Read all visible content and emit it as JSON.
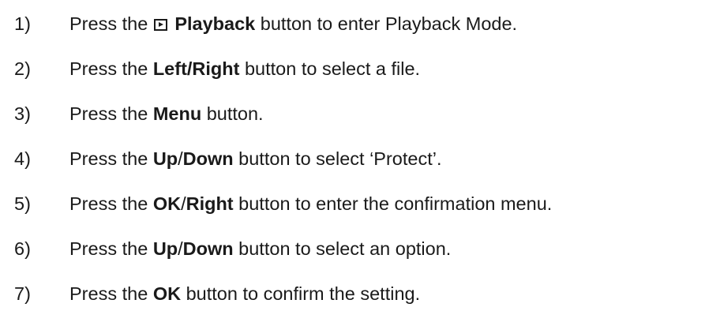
{
  "steps": [
    {
      "number": "1)",
      "pre": "Press the",
      "icon": "playback-icon",
      "bold": "Playback",
      "post": "button to enter Playback Mode."
    },
    {
      "number": "2)",
      "pre": "Press the",
      "bold": "Left/Right",
      "post": "button to select a file."
    },
    {
      "number": "3)",
      "pre": "Press the",
      "bold": "Menu",
      "post": "button."
    },
    {
      "number": "4)",
      "pre": "Press the",
      "bold_a": "Up",
      "sep": "/",
      "bold_b": "Down",
      "post": "button to select ‘Protect’."
    },
    {
      "number": "5)",
      "pre": "Press the",
      "bold_a": "OK",
      "sep": "/",
      "bold_b": "Right",
      "post": "button to enter the confirmation menu."
    },
    {
      "number": "6)",
      "pre": "Press the",
      "bold_a": "Up",
      "sep": "/",
      "bold_b": "Down",
      "post": "button to select an option."
    },
    {
      "number": "7)",
      "pre": "Press the",
      "bold": "OK",
      "post": "button to confirm the setting."
    }
  ]
}
